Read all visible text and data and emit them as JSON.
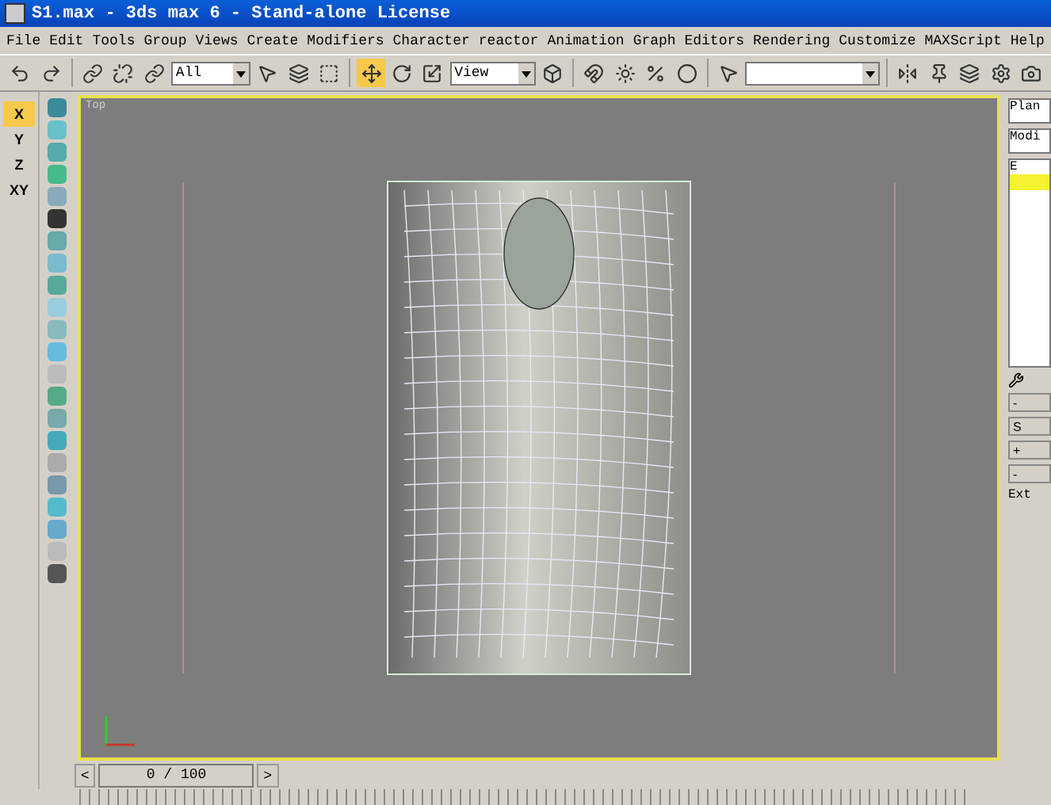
{
  "window": {
    "title": "S1.max - 3ds max 6 - Stand-alone License"
  },
  "menu": [
    "File",
    "Edit",
    "Tools",
    "Group",
    "Views",
    "Create",
    "Modifiers",
    "Character",
    "reactor",
    "Animation",
    "Graph Editors",
    "Rendering",
    "Customize",
    "MAXScript",
    "Help"
  ],
  "toolbar": {
    "selection_filter": "All",
    "reference_coord": "View"
  },
  "axis_buttons": [
    {
      "label": "X",
      "selected": true
    },
    {
      "label": "Y",
      "selected": false
    },
    {
      "label": "Z",
      "selected": false
    },
    {
      "label": "XY",
      "selected": false
    }
  ],
  "viewport": {
    "label": "Top"
  },
  "command_panel": {
    "object_name": "Plan",
    "modifier_list": "Modi",
    "stack_item": "E",
    "rollout_buttons": [
      "-",
      "+",
      "-"
    ],
    "button": "S",
    "footer": "Ext"
  },
  "timeline": {
    "frame": "0 / 100",
    "prev": "<",
    "next": ">"
  }
}
